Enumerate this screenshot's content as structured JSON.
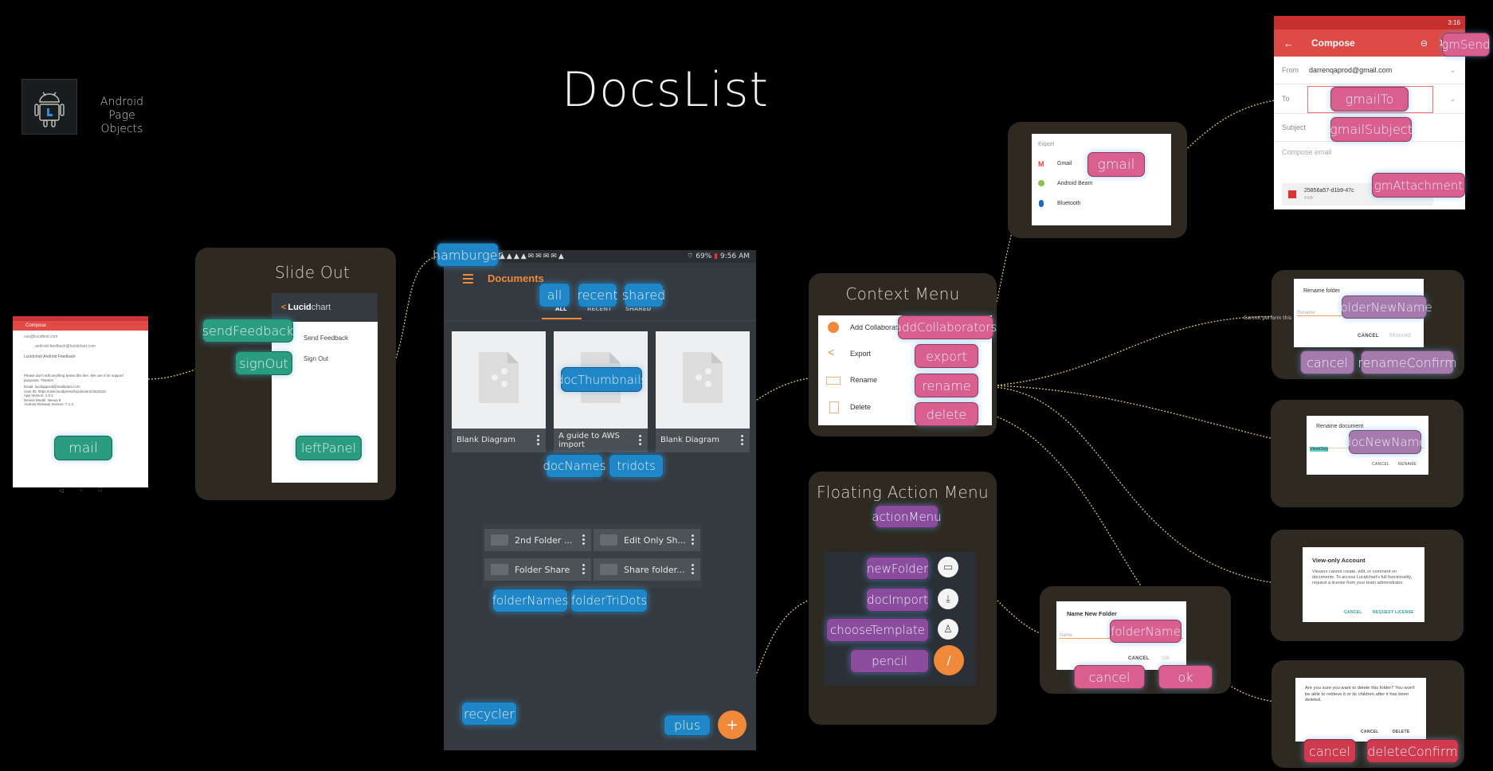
{
  "header": {
    "logo_label": "Android Page Objects",
    "title": "DocsList"
  },
  "mail_screen": {
    "app_bar_title": "Compose",
    "from": "cuo@lucidtest.com",
    "to": "android-feedback@lucidchart.com",
    "subject": "Lucidchart Android Feedback",
    "body_lines": [
      "Please don't edit anything below this line. We use it for support purposes. Thanks!",
      "Email: lucidqaprod@mailinator.com",
      "User ID: https://user.lucidpress/lucid/users/3323423",
      "App Version: 1.0.1",
      "Device Model: Nexus 9",
      "Android Release Version: 7.1.2"
    ],
    "tag": "mail"
  },
  "slide_out": {
    "title": "Slide Out",
    "brand_bold": "Lucid",
    "brand_light": "chart",
    "items": [
      "Send Feedback",
      "Sign Out"
    ],
    "tags": {
      "send_feedback": "sendFeedback",
      "sign_out": "signOut",
      "left_panel": "leftPanel"
    }
  },
  "documents": {
    "status_time": "9:56 AM",
    "status_battery": "69%",
    "toolbar_title": "Documents",
    "tabs": [
      "ALL",
      "RECENT",
      "SHARED"
    ],
    "docs": [
      {
        "name": "Blank Diagram"
      },
      {
        "name": "A guide to AWS import"
      },
      {
        "name": "Blank Diagram"
      }
    ],
    "folders": [
      "2nd Folder ...",
      "Edit Only Sh...",
      "Folder Share",
      "Share folder..."
    ],
    "tags": {
      "hamburger": "hamburger",
      "all": "all",
      "recent": "recent",
      "shared": "shared",
      "doc_thumbnails": "docThumbnails",
      "doc_names": "docNames",
      "tridots": "tridots",
      "folder_names": "folderNames",
      "folder_tridots": "folderTriDots",
      "recycler": "recycler",
      "plus": "plus"
    },
    "fab_symbol": "+",
    "accent": "#f08a3a"
  },
  "context_menu": {
    "title": "Context Menu",
    "items": [
      "Add Collaborators",
      "Export",
      "Rename",
      "Delete"
    ],
    "tags": {
      "add": "addCollaborators",
      "export": "export",
      "rename": "rename",
      "delete": "delete"
    }
  },
  "fab_menu": {
    "title": "Floating Action Menu",
    "tags": {
      "action_menu": "actionMenu",
      "new_folder": "newFolder",
      "doc_import": "docImport",
      "choose_template": "chooseTemplate",
      "pencil": "pencil"
    }
  },
  "export_sheet": {
    "header": "Export",
    "items": [
      "Gmail",
      "Android Beam",
      "Bluetooth"
    ],
    "tag": "gmail"
  },
  "gmail_compose": {
    "status_time": "3:16",
    "title": "Compose",
    "from_label": "From",
    "from_value": "darrenqaprod@gmail.com",
    "to_label": "To",
    "subject_label": "Subject",
    "compose_placeholder": "Compose email",
    "attachment_name": "25856a57-d1b9-47c",
    "attachment_size": "4 KB",
    "tags": {
      "send": "gmSend",
      "to": "gmailTo",
      "subject": "gmailSubject",
      "attachment": "gmAttachment"
    }
  },
  "rename_folder": {
    "title": "Rename folder",
    "placeholder": "Rename",
    "error_note": "Cannot perform this action",
    "cancel": "CANCEL",
    "confirm": "RENAME",
    "tags": {
      "new_name": "folderNewName",
      "cancel": "cancel",
      "confirm": "renameConfirm"
    }
  },
  "rename_document": {
    "title": "Rename document",
    "value": "ViewOnly",
    "cancel": "CANCEL",
    "confirm": "RENAME",
    "tags": {
      "new_name": "docNewName"
    }
  },
  "view_only": {
    "title": "View-only Account",
    "body": "Viewers cannot create, edit, or comment on documents. To access Lucidchart's full functionality, request a license from your team administrator.",
    "cancel": "CANCEL",
    "request": "REQUEST LICENSE"
  },
  "delete_folder": {
    "body": "Are you sure you want to delete this folder? You won't be able to retrieve it or its children after it has been deleted.",
    "cancel": "CANCEL",
    "confirm": "DELETE",
    "tags": {
      "cancel": "cancel",
      "confirm": "deleteConfirm"
    }
  },
  "new_folder": {
    "title": "Name New Folder",
    "placeholder": "Name",
    "cancel": "CANCEL",
    "ok": "OK",
    "tags": {
      "name": "folderName",
      "cancel": "cancel",
      "ok": "ok"
    }
  }
}
